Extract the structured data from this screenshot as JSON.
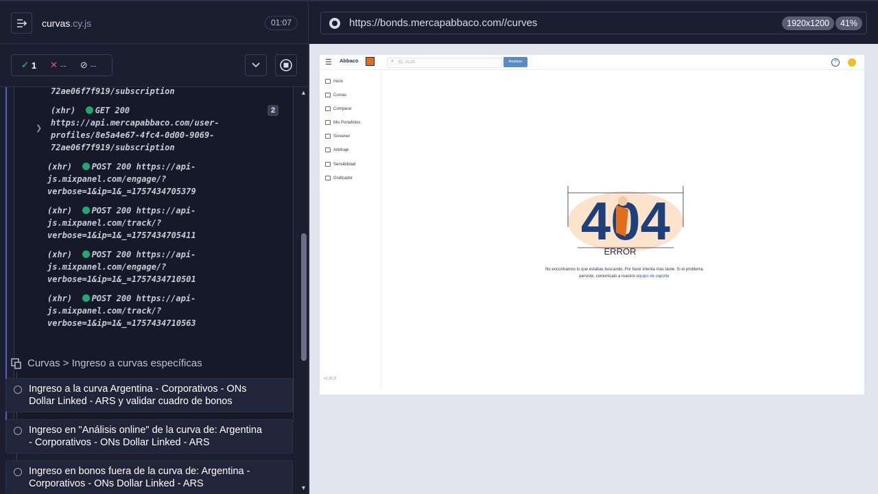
{
  "runner": {
    "spec_name": "curvas",
    "spec_ext": ".cy.js",
    "timer": "01:07",
    "stats": {
      "passed": "1",
      "failed": "--",
      "pending": "--"
    }
  },
  "log": {
    "top_partial": "72ae06f7f919/subscription",
    "xhr_get": {
      "prefix": "(xhr)",
      "status": "GET 200",
      "url_lines": [
        "https://api.mercapabbaco.com/user-",
        "profiles/8e5a4e67-4fc4-0d00-9069-",
        "72ae06f7f919/subscription"
      ],
      "count": "2"
    },
    "entries": [
      {
        "prefix": "(xhr)",
        "status": "POST 200",
        "lines": [
          "https://api-",
          "js.mixpanel.com/engage/?",
          "verbose=1&ip=1&_=1757434705379"
        ]
      },
      {
        "prefix": "(xhr)",
        "status": "POST 200",
        "lines": [
          "https://api-",
          "js.mixpanel.com/track/?",
          "verbose=1&ip=1&_=1757434705411"
        ]
      },
      {
        "prefix": "(xhr)",
        "status": "POST 200",
        "lines": [
          "https://api-",
          "js.mixpanel.com/engage/?",
          "verbose=1&ip=1&_=1757434710501"
        ]
      },
      {
        "prefix": "(xhr)",
        "status": "POST 200",
        "lines": [
          "https://api-",
          "js.mixpanel.com/track/?",
          "verbose=1&ip=1&_=1757434710563"
        ]
      }
    ]
  },
  "suite": {
    "title": "Curvas > Ingreso a curvas específicas"
  },
  "tests": [
    {
      "line1": "Ingreso a la curva Argentina - Corporativos - ONs",
      "line2": "Dollar Linked - ARS y validar cuadro de bonos"
    },
    {
      "line1": "Ingreso en \"Análisis online\" de la curva de: Argentina",
      "line2": "- Corporativos - ONs Dollar Linked - ARS"
    },
    {
      "line1": "Ingreso en bonos fuera de la curva de: Argentina -",
      "line2": "Corporativos - ONs Dollar Linked - ARS"
    }
  ],
  "browser": {
    "url": "https://bonds.mercapabbaco.com//curves",
    "resolution": "1920x1200",
    "zoom": "41%"
  },
  "app": {
    "logo": "Abbaco",
    "search_placeholder": "Ej.: AL30",
    "analyze_label": "Analizar",
    "nav": [
      "Inicio",
      "Curvas",
      "Comparar",
      "Mis Portafolios",
      "Screener",
      "Arbitraje",
      "Sensibilidad",
      "Graficador"
    ],
    "version": "v1.31.0",
    "error_code": "404",
    "error_word": "ERROR",
    "error_message_1": "No encontramos lo que estabas buscando. Por favor intenta más tarde. Si el problema",
    "error_message_2": "persiste, comunícalo a nuestro",
    "error_link": "equipo de soporte"
  },
  "colors": {
    "pass": "#1fa971",
    "fail": "#e45770",
    "accent": "#5b5fc8",
    "brand_orange": "#e26d1b",
    "brand_navy": "#1d2a55"
  }
}
